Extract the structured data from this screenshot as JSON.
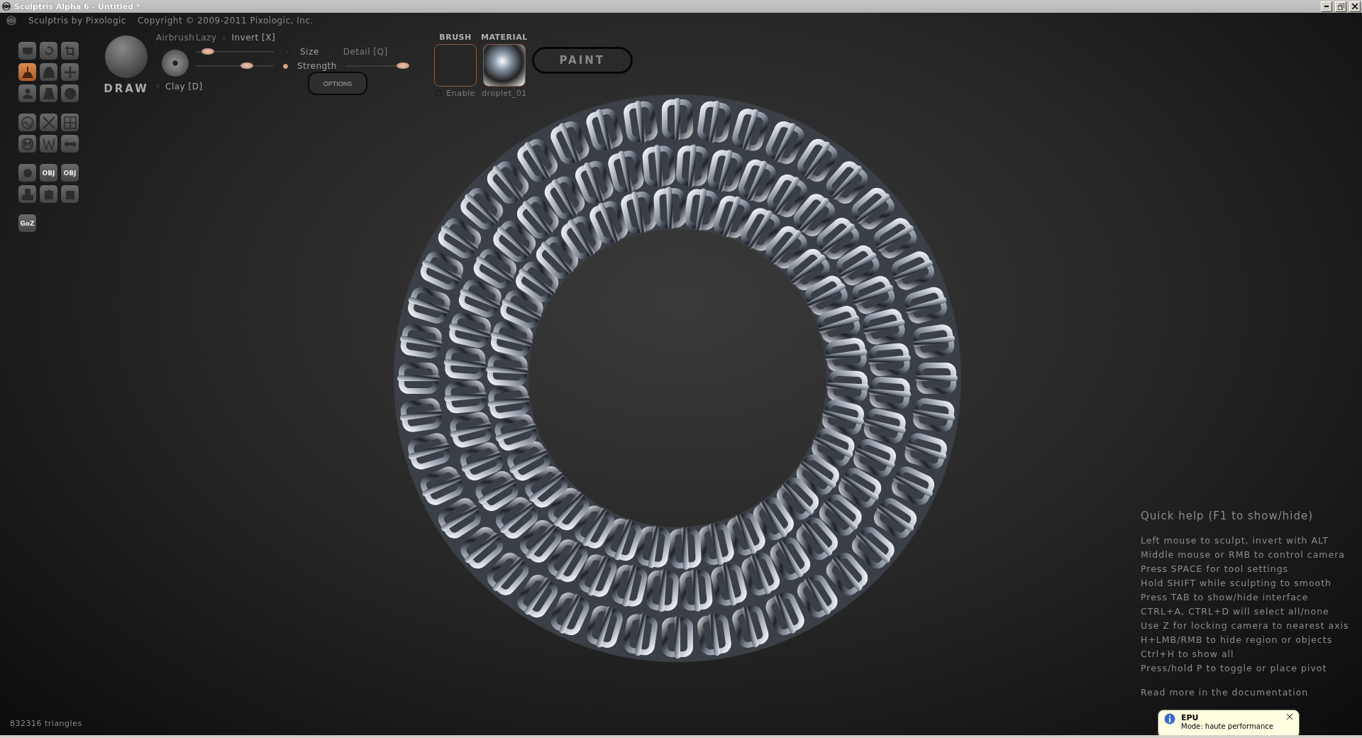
{
  "window": {
    "title": "Sculptris Alpha 6 - Untitled *"
  },
  "header": {
    "app_name": "Sculptris by Pixologic",
    "copyright": "Copyright © 2009-2011 Pixologic, Inc."
  },
  "tool_groups": [
    {
      "tools": [
        {
          "selected": false
        },
        {
          "selected": false
        },
        {
          "selected": false
        },
        {
          "selected": true
        },
        {
          "selected": false
        },
        {
          "selected": false
        },
        {
          "selected": false
        },
        {
          "selected": false
        },
        {
          "selected": false
        }
      ]
    },
    {
      "tools": [
        {
          "selected": false
        },
        {
          "selected": false
        },
        {
          "selected": false
        },
        {
          "selected": false
        },
        {
          "selected": false
        },
        {
          "selected": false
        }
      ]
    },
    {
      "tools": [
        {
          "selected": false
        },
        {
          "selected": false,
          "label": "OBJ"
        },
        {
          "selected": false,
          "label": "OBJ"
        },
        {
          "selected": false
        },
        {
          "selected": false
        },
        {
          "selected": false
        }
      ]
    },
    {
      "tools": [
        {
          "selected": false,
          "label": "GoZ"
        }
      ]
    }
  ],
  "brush_panel": {
    "tool_name": "DRAW",
    "airbrush": "Airbrush",
    "lazy": "Lazy",
    "invert": {
      "label": "Invert [X]",
      "on": false
    },
    "size": {
      "label": "Size",
      "on": false,
      "level": 0.15
    },
    "strength": {
      "label": "Strength",
      "on": true,
      "level": 0.65
    },
    "detail": {
      "label": "Detail [Q]",
      "level": 0.9
    },
    "options": "OPTIONS",
    "clay": {
      "label": "Clay [D]",
      "on": false
    }
  },
  "brush": {
    "title": "BRUSH",
    "enable": {
      "label": "Enable",
      "on": false
    }
  },
  "material": {
    "title": "MATERIAL",
    "name": "droplet_01"
  },
  "paint_button": "PAINT",
  "quick_help": {
    "title": "Quick help (F1 to show/hide)",
    "lines": [
      "Left mouse to sculpt, invert with ALT",
      "Middle mouse or RMB to control camera",
      "Press SPACE for tool settings",
      "Hold SHIFT while sculpting to smooth",
      "Press TAB to show/hide interface",
      "CTRL+A, CTRL+D will select all/none",
      "Use Z for locking camera to nearest axis",
      "H+LMB/RMB to hide region or objects",
      "Ctrl+H to show all",
      "Press/hold P to toggle or place pivot"
    ],
    "link": "Read more in the documentation"
  },
  "status": {
    "triangles": "832316 triangles"
  },
  "notification": {
    "title": "EPU",
    "message": "Mode: haute performance"
  }
}
